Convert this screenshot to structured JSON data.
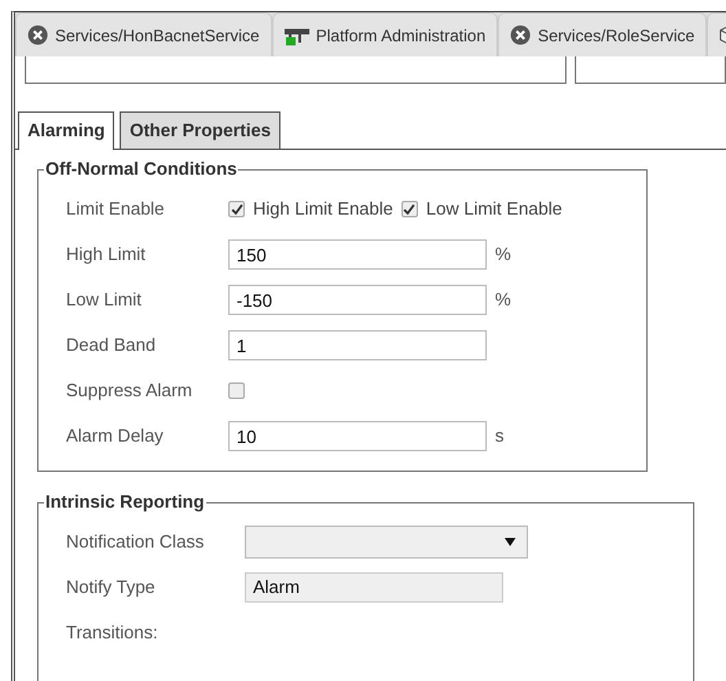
{
  "top_tabs": [
    {
      "kind": "error",
      "label": "Services/HonBacnetService"
    },
    {
      "kind": "server",
      "label": "Platform Administration"
    },
    {
      "kind": "error",
      "label": "Services/RoleService"
    },
    {
      "kind": "cube"
    }
  ],
  "tabs": [
    {
      "label": "Alarming",
      "selected": true
    },
    {
      "label": "Other Properties",
      "selected": false
    }
  ],
  "off_normal": {
    "title": "Off-Normal Conditions",
    "rows": [
      {
        "kind": "checks",
        "label": "Limit Enable",
        "options": [
          {
            "label": "High Limit Enable",
            "checked": true
          },
          {
            "label": "Low Limit Enable",
            "checked": true
          }
        ]
      },
      {
        "kind": "field",
        "label": "High Limit",
        "value": "150",
        "unit": "%"
      },
      {
        "kind": "field",
        "label": "Low Limit",
        "value": "-150",
        "unit": "%"
      },
      {
        "kind": "field",
        "label": "Dead Band",
        "value": "1"
      },
      {
        "kind": "checkbox",
        "label": "Suppress Alarm",
        "checked": false
      },
      {
        "kind": "field",
        "label": "Alarm Delay",
        "value": "10",
        "unit": "s"
      }
    ]
  },
  "intrinsic": {
    "title": "Intrinsic Reporting",
    "rows": [
      {
        "kind": "select",
        "label": "Notification Class"
      },
      {
        "kind": "readonly",
        "label": "Notify Type",
        "value": "Alarm"
      },
      {
        "kind": "heading",
        "label": "Transitions:"
      }
    ]
  }
}
